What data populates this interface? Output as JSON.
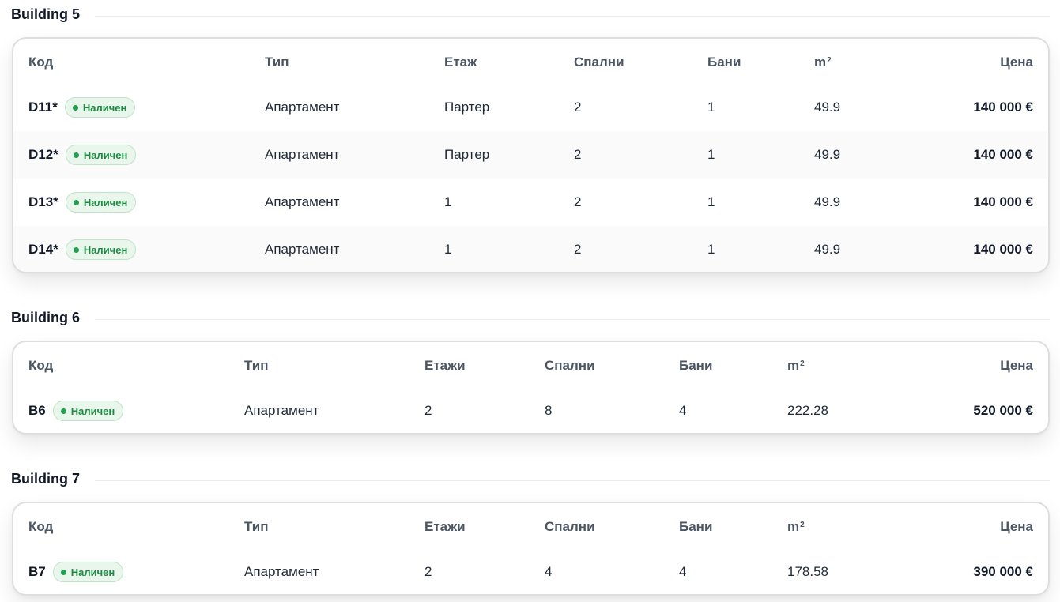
{
  "status_color": "#22a04f",
  "buildings": [
    {
      "title": "Building 5",
      "columns": {
        "code": "Код",
        "type": "Тип",
        "floor": "Етаж",
        "bedrooms": "Спални",
        "baths": "Бани",
        "area": "m",
        "area_sup": "2",
        "price": "Цена"
      },
      "rows": [
        {
          "code": "D11*",
          "status": "Наличен",
          "type": "Апартамент",
          "floor": "Партер",
          "bedrooms": "2",
          "baths": "1",
          "area": "49.9",
          "price": "140 000 €"
        },
        {
          "code": "D12*",
          "status": "Наличен",
          "type": "Апартамент",
          "floor": "Партер",
          "bedrooms": "2",
          "baths": "1",
          "area": "49.9",
          "price": "140 000 €"
        },
        {
          "code": "D13*",
          "status": "Наличен",
          "type": "Апартамент",
          "floor": "1",
          "bedrooms": "2",
          "baths": "1",
          "area": "49.9",
          "price": "140 000 €"
        },
        {
          "code": "D14*",
          "status": "Наличен",
          "type": "Апартамент",
          "floor": "1",
          "bedrooms": "2",
          "baths": "1",
          "area": "49.9",
          "price": "140 000 €"
        }
      ]
    },
    {
      "title": "Building 6",
      "columns": {
        "code": "Код",
        "type": "Тип",
        "floor": "Етажи",
        "bedrooms": "Спални",
        "baths": "Бани",
        "area": "m",
        "area_sup": "2",
        "price": "Цена"
      },
      "rows": [
        {
          "code": "B6",
          "status": "Наличен",
          "type": "Апартамент",
          "floor": "2",
          "bedrooms": "8",
          "baths": "4",
          "area": "222.28",
          "price": "520 000 €"
        }
      ]
    },
    {
      "title": "Building 7",
      "columns": {
        "code": "Код",
        "type": "Тип",
        "floor": "Етажи",
        "bedrooms": "Спални",
        "baths": "Бани",
        "area": "m",
        "area_sup": "2",
        "price": "Цена"
      },
      "rows": [
        {
          "code": "B7",
          "status": "Наличен",
          "type": "Апартамент",
          "floor": "2",
          "bedrooms": "4",
          "baths": "4",
          "area": "178.58",
          "price": "390 000 €"
        }
      ]
    }
  ]
}
